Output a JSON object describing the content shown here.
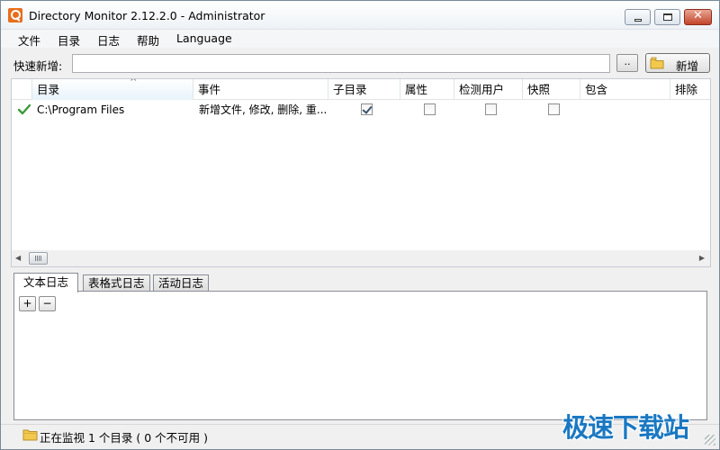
{
  "window": {
    "title": "Directory Monitor 2.12.2.0 - Administrator",
    "close_glyph": "✕"
  },
  "menu": [
    "文件",
    "目录",
    "日志",
    "帮助",
    "Language"
  ],
  "quick_add": {
    "label": "快速新增:",
    "value": "",
    "placeholder": "",
    "browse_label": "..",
    "new_label": "新增",
    "new_icon": "folder-plus-icon"
  },
  "grid": {
    "columns": [
      "目录",
      "事件",
      "子目录",
      "属性",
      "检测用户",
      "快照",
      "包含",
      "排除"
    ],
    "sort_indicator": "^",
    "rows": [
      {
        "status_icon": "check-icon",
        "directory": "C:\\Program Files",
        "events": "新增文件, 修改, 删除, 重...",
        "subdirectories": true,
        "attributes": false,
        "detect_user": false,
        "snapshot": false,
        "include": "",
        "exclude": ""
      }
    ],
    "scroll_left": "◀",
    "scroll_right": "▶"
  },
  "log_tabs": {
    "tabs": [
      "文本日志",
      "表格式日志",
      "活动日志"
    ],
    "active": 0,
    "expand_label": "+",
    "collapse_label": "−"
  },
  "status": {
    "text": "正在监视 1 个目录 ( 0 个不可用 )",
    "icon": "folder-icon"
  },
  "watermark": "极速下载站",
  "colors": {
    "accent": "#e86e1c",
    "check_green": "#3a9b3a",
    "folder_yellow": "#f2c94c",
    "watermark_blue": "#1a78c2"
  }
}
